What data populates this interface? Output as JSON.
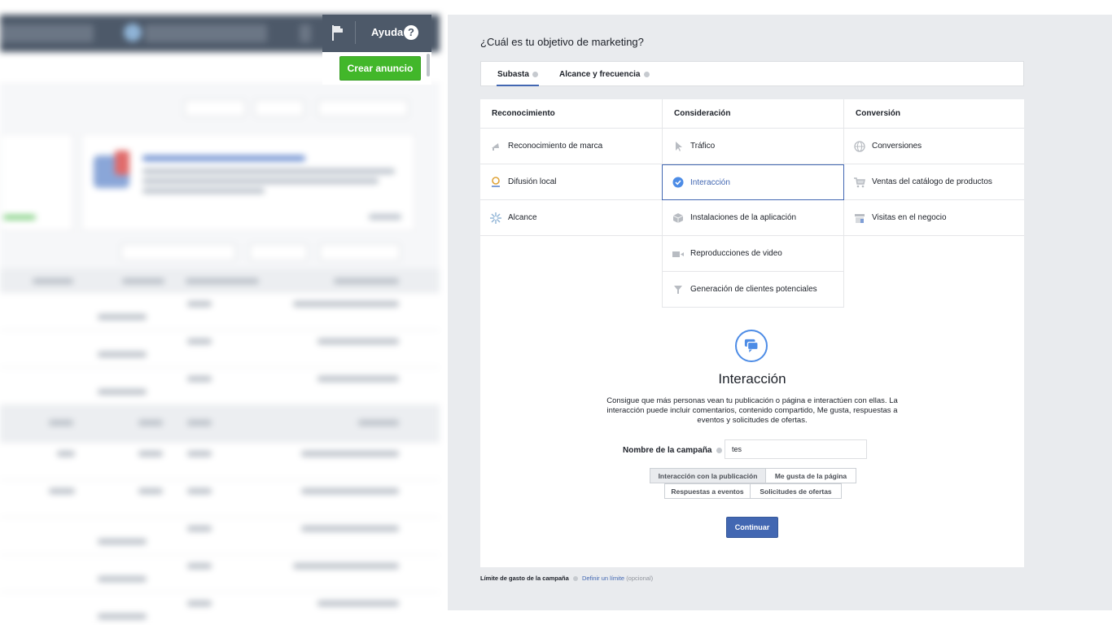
{
  "header": {
    "help_label": "Ayuda",
    "help_icon_glyph": "?",
    "create_ad_label": "Crear anuncio"
  },
  "modal": {
    "title": "¿Cuál es tu objetivo de marketing?",
    "buying_tabs": [
      {
        "label": "Subasta",
        "active": true
      },
      {
        "label": "Alcance y frecuencia",
        "active": false
      }
    ],
    "columns": [
      {
        "header": "Reconocimiento",
        "items": [
          {
            "label": "Reconocimiento de marca",
            "icon": "megaphone-icon",
            "selected": false
          },
          {
            "label": "Difusión local",
            "icon": "location-pin-icon",
            "selected": false
          },
          {
            "label": "Alcance",
            "icon": "reach-burst-icon",
            "selected": false
          }
        ]
      },
      {
        "header": "Consideración",
        "items": [
          {
            "label": "Tráfico",
            "icon": "cursor-icon",
            "selected": false
          },
          {
            "label": "Interacción",
            "icon": "check-circle-icon",
            "selected": true
          },
          {
            "label": "Instalaciones de la aplicación",
            "icon": "app-box-icon",
            "selected": false
          },
          {
            "label": "Reproducciones de video",
            "icon": "video-camera-icon",
            "selected": false
          },
          {
            "label": "Generación de clientes potenciales",
            "icon": "funnel-icon",
            "selected": false
          }
        ]
      },
      {
        "header": "Conversión",
        "items": [
          {
            "label": "Conversiones",
            "icon": "globe-icon",
            "selected": false
          },
          {
            "label": "Ventas del catálogo de productos",
            "icon": "shopping-cart-icon",
            "selected": false
          },
          {
            "label": "Visitas en el negocio",
            "icon": "store-icon",
            "selected": false
          }
        ]
      }
    ],
    "detail": {
      "icon": "chat-bubbles-icon",
      "title": "Interacción",
      "description": "Consigue que más personas vean tu publicación o página e interactúen con ellas. La interacción puede incluir comentarios, contenido compartido, Me gusta, respuestas a eventos y solicitudes de ofertas.",
      "campaign_name_label": "Nombre de la campaña",
      "campaign_name_value": "tes",
      "options": [
        {
          "label": "Interacción con la publicación",
          "selected": true
        },
        {
          "label": "Me gusta de la página",
          "selected": false
        },
        {
          "label": "Respuestas a eventos",
          "selected": false
        },
        {
          "label": "Solicitudes de ofertas",
          "selected": false
        }
      ],
      "continue_label": "Continuar"
    },
    "spend_limit": {
      "label": "Límite de gasto de la campaña",
      "link": "Definir un límite",
      "optional": "(opcional)"
    }
  },
  "colors": {
    "topbar": "#4d5969",
    "create_ad_green": "#42b72a",
    "facebook_blue": "#4267b2",
    "modal_background": "#e9ebee"
  }
}
